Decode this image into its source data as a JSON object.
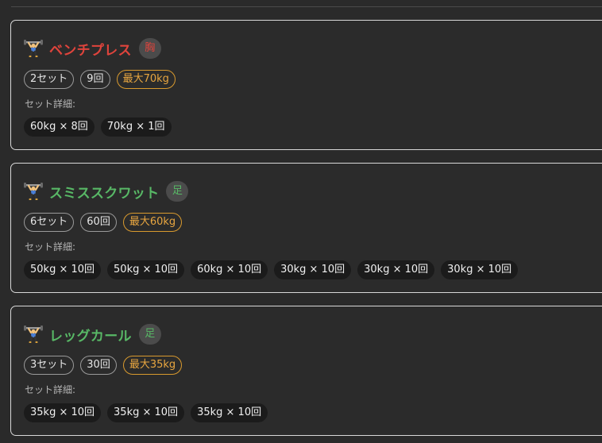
{
  "colors": {
    "chest": "#e0443c",
    "leg": "#58b866",
    "max_tag": "#e8a640"
  },
  "detail_label": "セット詳細:",
  "icon": "weightlifter-icon",
  "exercises": [
    {
      "name": "ベンチプレス",
      "part": "胸",
      "part_color": "chest",
      "tags": {
        "sets": "2セット",
        "reps": "9回",
        "max": "最大70kg"
      },
      "set_details": [
        "60kg × 8回",
        "70kg × 1回"
      ]
    },
    {
      "name": "スミススクワット",
      "part": "足",
      "part_color": "leg",
      "tags": {
        "sets": "6セット",
        "reps": "60回",
        "max": "最大60kg"
      },
      "set_details": [
        "50kg × 10回",
        "50kg × 10回",
        "60kg × 10回",
        "30kg × 10回",
        "30kg × 10回",
        "30kg × 10回"
      ]
    },
    {
      "name": "レッグカール",
      "part": "足",
      "part_color": "leg",
      "tags": {
        "sets": "3セット",
        "reps": "30回",
        "max": "最大35kg"
      },
      "set_details": [
        "35kg × 10回",
        "35kg × 10回",
        "35kg × 10回"
      ]
    }
  ]
}
